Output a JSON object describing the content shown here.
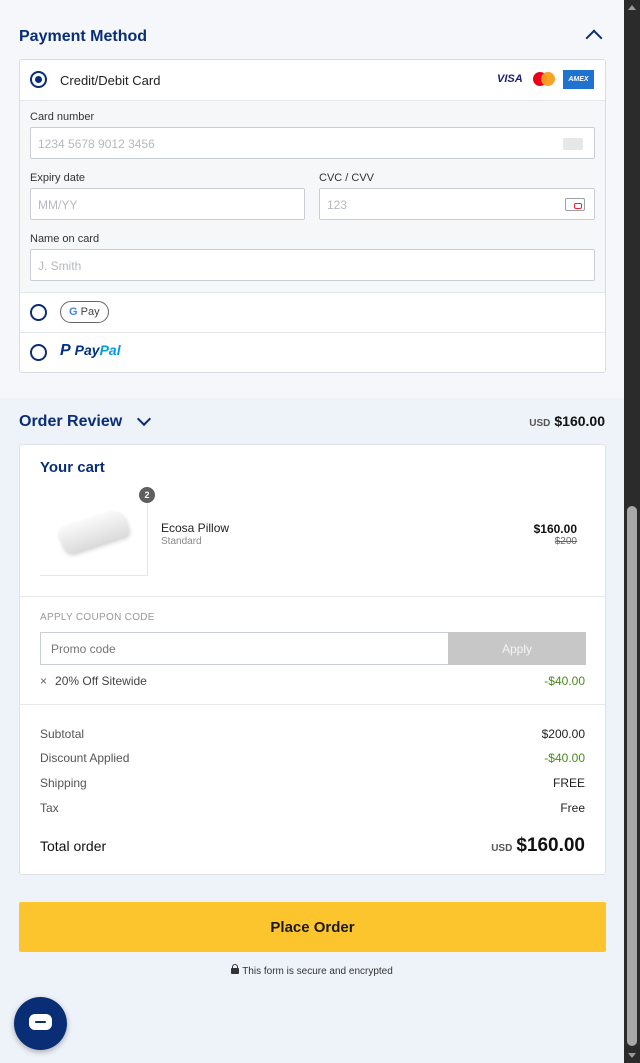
{
  "payment": {
    "title": "Payment Method",
    "card_option_label": "Credit/Debit Card",
    "card_logos": {
      "visa": "VISA",
      "amex": "AMEX"
    },
    "fields": {
      "card_number": {
        "label": "Card number",
        "placeholder": "1234 5678 9012 3456"
      },
      "expiry": {
        "label": "Expiry date",
        "placeholder": "MM/YY"
      },
      "cvc": {
        "label": "CVC / CVV",
        "placeholder": "123"
      },
      "name": {
        "label": "Name on card",
        "placeholder": "J. Smith"
      }
    },
    "gpay_label": {
      "g": "G",
      "pay": "Pay"
    },
    "paypal_label": {
      "p": "P",
      "pay": "Pay",
      "pal": "Pal"
    }
  },
  "review": {
    "title": "Order Review",
    "currency": "USD",
    "total": "$160.00"
  },
  "cart": {
    "title": "Your cart",
    "items": [
      {
        "qty": "2",
        "name": "Ecosa Pillow",
        "variant": "Standard",
        "price": "$160.00",
        "original_price": "$200"
      }
    ],
    "coupon": {
      "label": "APPLY COUPON CODE",
      "placeholder": "Promo code",
      "apply_label": "Apply",
      "applied": {
        "remove": "×",
        "name": "20% Off Sitewide",
        "amount": "-$40.00"
      }
    },
    "summary": {
      "subtotal_label": "Subtotal",
      "subtotal": "$200.00",
      "discount_label": "Discount Applied",
      "discount": "-$40.00",
      "shipping_label": "Shipping",
      "shipping": "FREE",
      "tax_label": "Tax",
      "tax": "Free"
    },
    "total": {
      "label": "Total order",
      "currency": "USD",
      "value": "$160.00"
    }
  },
  "actions": {
    "place_order": "Place Order",
    "secure_note": "This form is secure and encrypted"
  },
  "colors": {
    "brand": "#0a2e76",
    "cta": "#fdc52d",
    "discount": "#4a8a1c"
  }
}
